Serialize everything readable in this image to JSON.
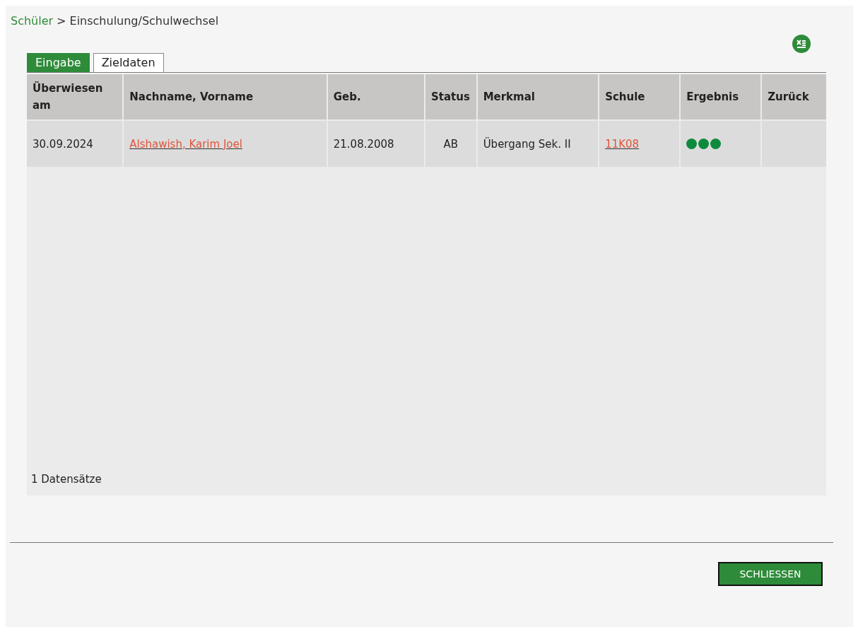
{
  "breadcrumb": {
    "parent": "Schüler",
    "separator": ">",
    "current": "Einschulung/Schulwechsel"
  },
  "tabs": [
    {
      "label": "Eingabe",
      "selected": true
    },
    {
      "label": "Zieldaten",
      "selected": false
    }
  ],
  "table": {
    "columns": [
      "Überwiesen am",
      "Nachname, Vorname",
      "Geb.",
      "Status",
      "Merkmal",
      "Schule",
      "Ergebnis",
      "Zurück"
    ],
    "rows": [
      {
        "transferred": "30.09.2024",
        "name": "Alshawish, Karim Joel",
        "born": "21.08.2008",
        "status": "AB",
        "feature": "Übergang Sek. II",
        "school": "11K08",
        "result": [
          {
            "color": "#0e8a3c"
          },
          {
            "color": "#0e8a3c"
          },
          {
            "color": "#0e8a3c"
          }
        ]
      }
    ]
  },
  "record_count": "1 Datensätze",
  "close_button": "SCHLIESSEN"
}
